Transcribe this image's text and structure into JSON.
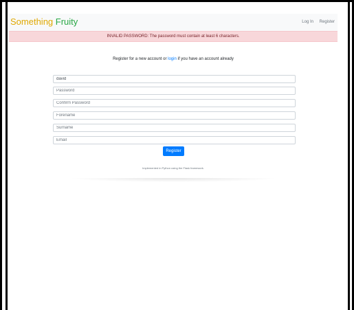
{
  "navbar": {
    "brand_part1": "Something",
    "brand_part2": "Fruity",
    "login_label": "Log In",
    "register_label": "Register"
  },
  "alert": {
    "message": "INVALID PASSWORD: The password must contain at least 6 characters."
  },
  "intro": {
    "before": "Register for a new account or ",
    "link": "login",
    "after": " if you have an account already"
  },
  "form": {
    "username_value": "david",
    "password_placeholder": "Password",
    "confirm_placeholder": "Confirm Password",
    "forename_placeholder": "Forename",
    "surname_placeholder": "Surname",
    "email_placeholder": "Email",
    "submit_label": "Register"
  },
  "footer": {
    "text": "Implemented in Python using the Flask framework."
  },
  "colors": {
    "brand_yellow": "#e0a800",
    "brand_green": "#28a745",
    "alert_bg": "#f8d7da",
    "alert_text": "#721c24",
    "primary": "#007bff"
  }
}
